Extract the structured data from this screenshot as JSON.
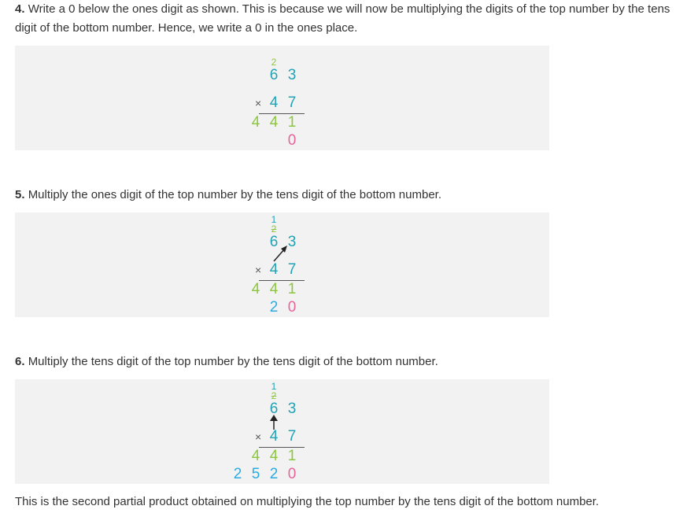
{
  "colors": {
    "teal": "#1fa3b5",
    "green": "#8cc63f",
    "pink": "#e8649b",
    "light_blue": "#29abe2",
    "panel_bg": "#f2f2f2",
    "text": "#333333"
  },
  "step4": {
    "number": "4.",
    "text": "Write a 0 below the ones digit as shown. This is because we will now be multiplying the digits of the top number by the tens digit of the bottom number. Hence, we write a 0 in the ones place.",
    "carry_top": "2",
    "top_tens": "6",
    "top_ones": "3",
    "times": "×",
    "bottom_tens": "4",
    "bottom_ones": "7",
    "partial1": [
      "4",
      "4",
      "1"
    ],
    "partial2": [
      "0"
    ]
  },
  "step5": {
    "number": "5.",
    "text": "Multiply the ones digit of the top number by the tens digit of the bottom number.",
    "carry_new": "1",
    "carry_old": "2",
    "top_tens": "6",
    "top_ones": "3",
    "times": "×",
    "bottom_tens": "4",
    "bottom_ones": "7",
    "partial1": [
      "4",
      "4",
      "1"
    ],
    "partial2": [
      "2",
      "0"
    ],
    "arrow_icon": "diagonal-arrow-icon"
  },
  "step6": {
    "number": "6.",
    "text": "Multiply the tens digit of the top number by the tens digit of the bottom number.",
    "carry_new": "1",
    "carry_old": "2",
    "top_tens": "6",
    "top_ones": "3",
    "times": "×",
    "bottom_tens": "4",
    "bottom_ones": "7",
    "partial1": [
      "4",
      "4",
      "1"
    ],
    "partial2": [
      "2",
      "5",
      "2",
      "0"
    ],
    "arrow_icon": "vertical-arrow-icon"
  },
  "conclusion": "This is the second partial product obtained on multiplying the top number by the tens digit of the bottom number."
}
